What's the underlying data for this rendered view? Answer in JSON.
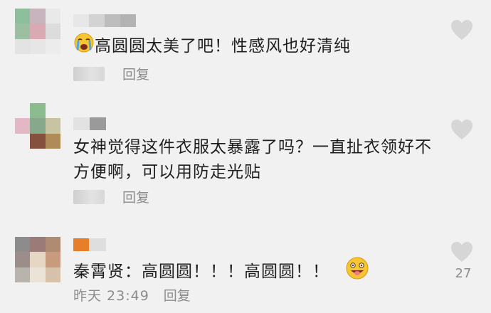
{
  "comments": [
    {
      "text": "高圆圆太美了吧！性感风也好清纯",
      "reply": "回复",
      "avatar_colors": [
        "#8dbf9c",
        "#c7b4bd",
        "#e9e9e9",
        "#9bbfa0",
        "#d9a9b4",
        "#dcdcdc",
        "#e3e3e3",
        "#e6e6e6",
        "#ececec"
      ],
      "leading_emoji": "crying-face-icon"
    },
    {
      "text": "女神觉得这件衣服太暴露了吗？一直扯衣领好不方便啊，可以用防走光贴",
      "reply": "回复",
      "avatar_colors": [
        "#f1f1f1",
        "#8bbb8f",
        "#f1f1f1",
        "#e3b7c4",
        "#85a98a",
        "#c7c3a3",
        "#f1f1f1",
        "#85503d",
        "#b08b5a"
      ]
    },
    {
      "text": "秦霄贤：高圆圆！！！高圆圆！！",
      "time": "昨天 23:49",
      "reply": "回复",
      "like_count": "27",
      "avatar_colors": [
        "#8c8c8c",
        "#9b7b78",
        "#b08b74",
        "#9c8d8a",
        "#e6d7c5",
        "#c89b7f",
        "#b8b3ad",
        "#ece3d7",
        "#d7c1aa"
      ],
      "trailing_emoji": "grinning-tongue-face-icon",
      "name_accent": "#e77e2a"
    }
  ],
  "colors": {
    "background": "#f1f1f1",
    "meta_text": "#8c8c8c",
    "like_icon": "#d6d6d6"
  }
}
